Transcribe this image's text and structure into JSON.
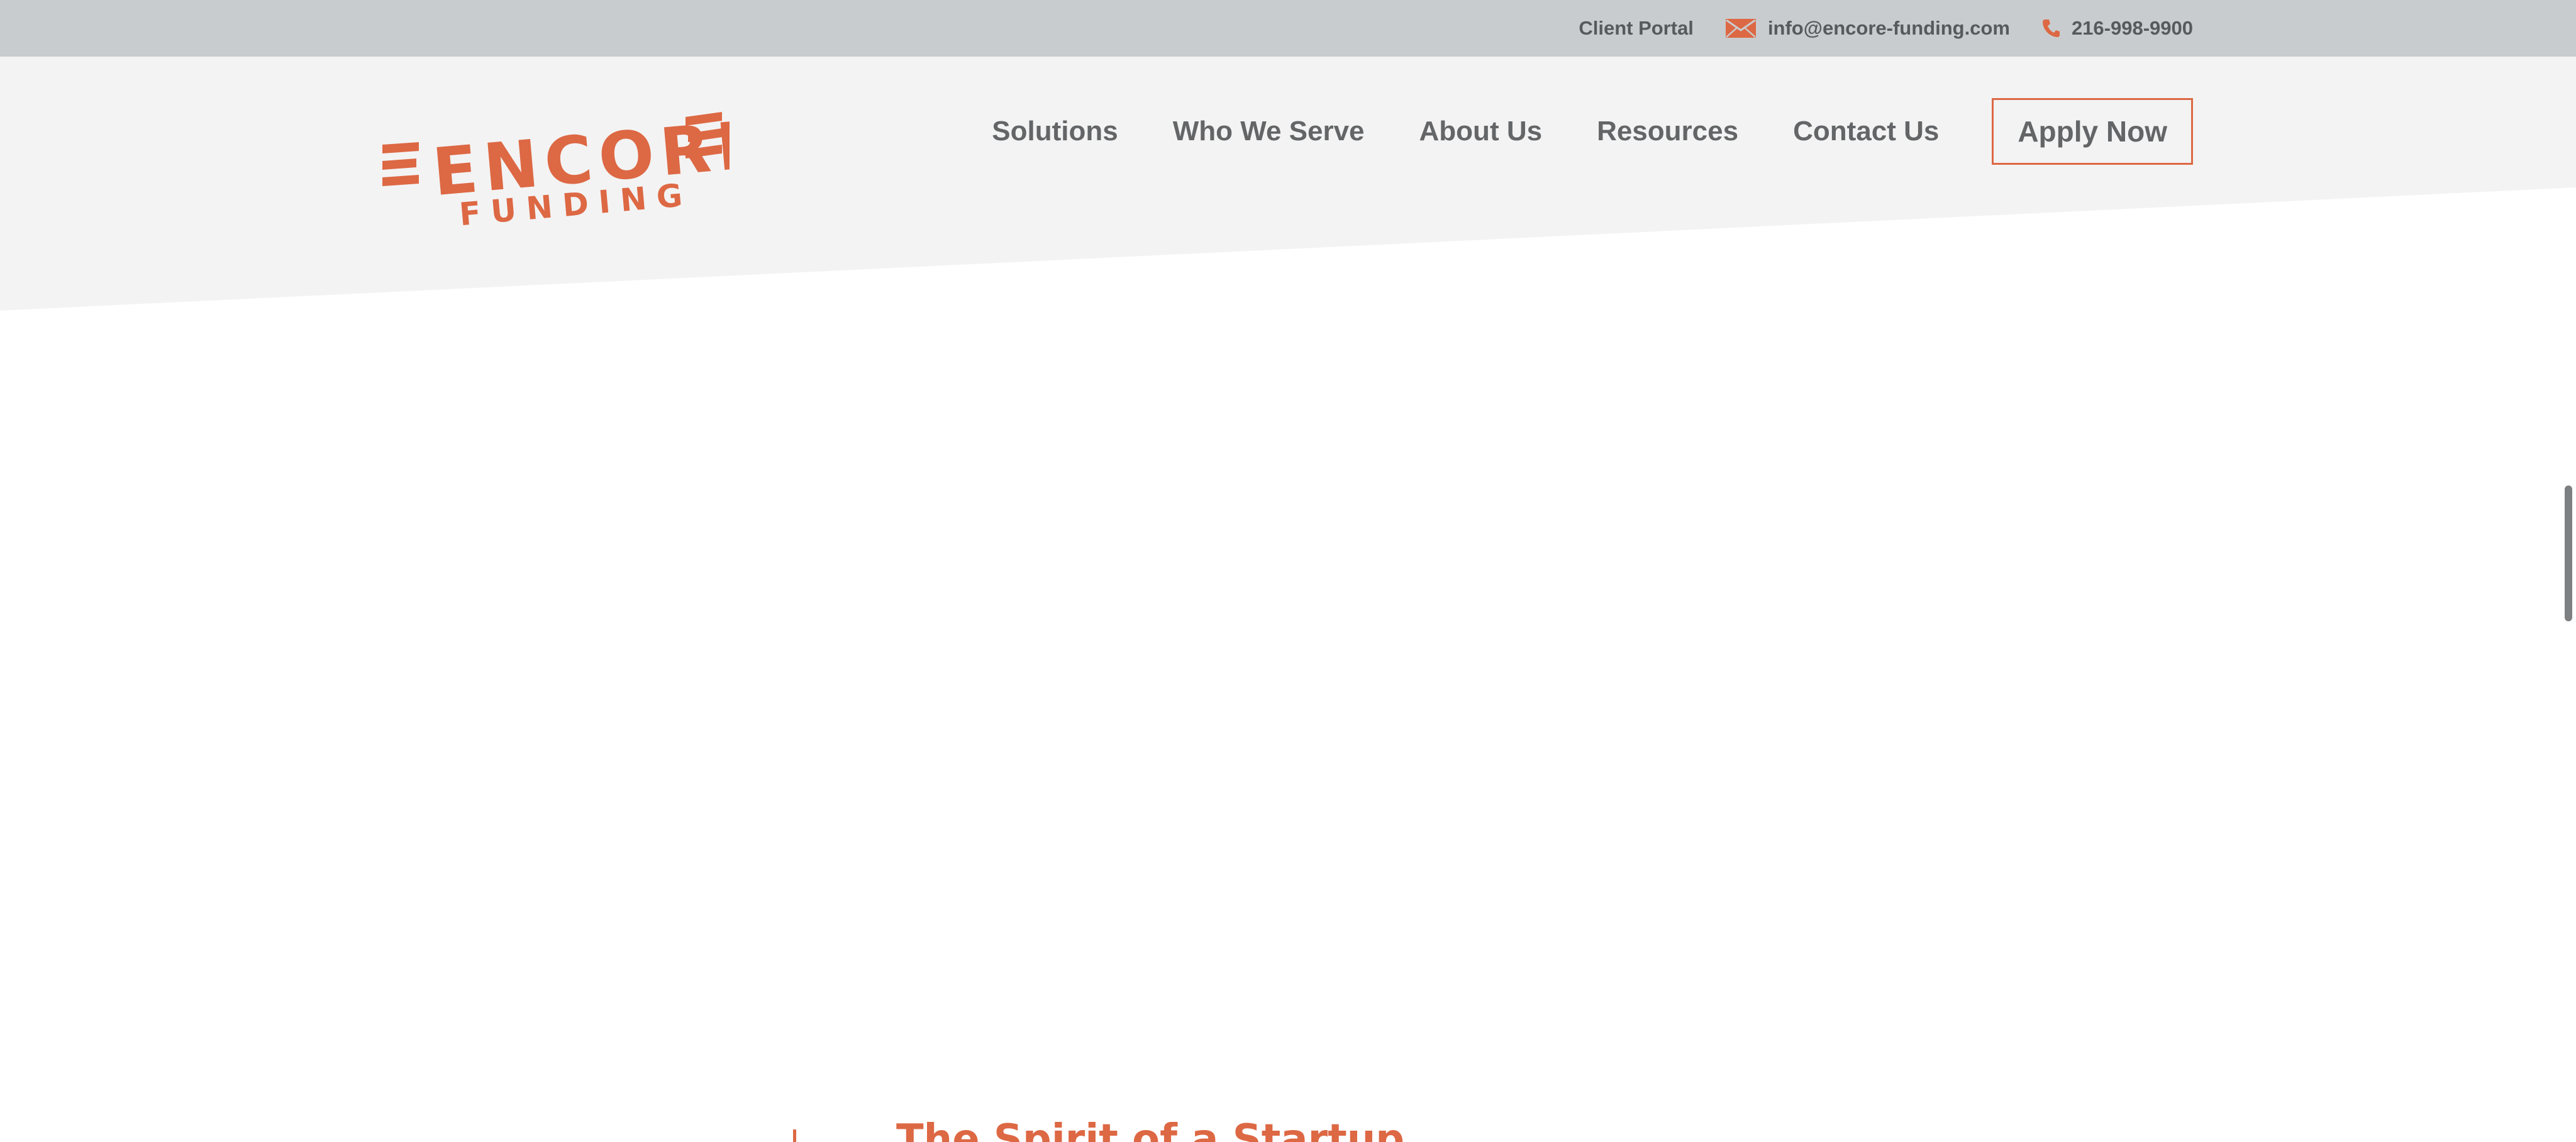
{
  "utility": {
    "client_portal": "Client Portal",
    "email": "info@encore-funding.com",
    "phone": "216-998-9900"
  },
  "logo": {
    "word_top": "ENCORE",
    "word_bottom": "FUNDING"
  },
  "nav": {
    "items": [
      {
        "label": "Solutions"
      },
      {
        "label": "Who We Serve"
      },
      {
        "label": "About Us"
      },
      {
        "label": "Resources"
      },
      {
        "label": "Contact Us"
      }
    ],
    "cta_label": "Apply Now"
  },
  "section": {
    "title": "The Spirit of a Startup"
  },
  "icons": {
    "email": "envelope-icon",
    "phone": "phone-icon"
  },
  "colors": {
    "brand_orange": "#dd6844",
    "utility_bar": "#c9ccce",
    "header_bg": "#f3f3f3",
    "nav_text": "#636567",
    "utility_text": "#575a5c",
    "page_bg": "#ffffff"
  }
}
